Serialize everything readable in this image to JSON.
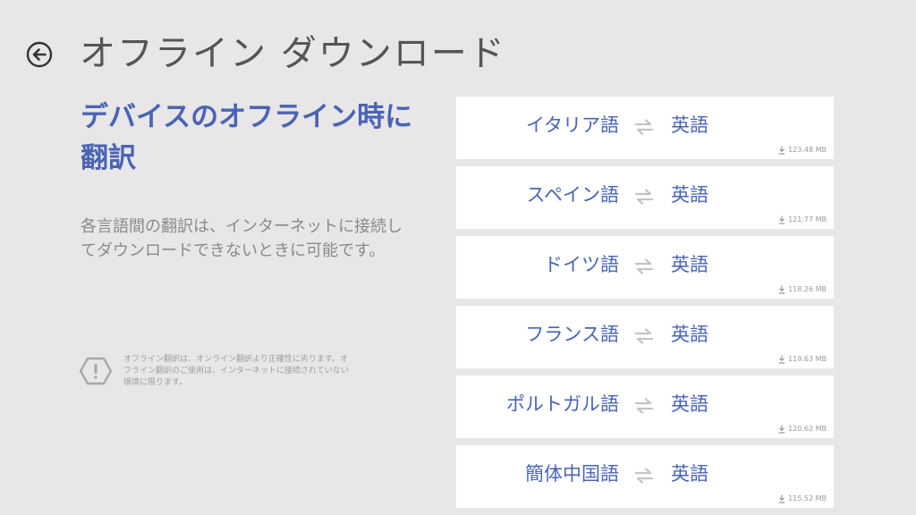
{
  "header": {
    "back_icon": "arrow-left-circle-icon",
    "title": "オフライン ダウンロード"
  },
  "intro": {
    "headline": "デバイスのオフライン時に翻訳",
    "description": "各言語間の翻訳は、インターネットに接続してダウンロードできないときに可能です。"
  },
  "notice": {
    "icon": "warning-hexagon-icon",
    "text": "オフライン翻訳は、オンライン翻訳より正確性に劣ります。オフライン翻訳のご使用は、インターネットに接続されていない環境に限ります。"
  },
  "languages": [
    {
      "source": "イタリア語",
      "target": "英語",
      "size": "123.48 MB"
    },
    {
      "source": "スペイン語",
      "target": "英語",
      "size": "121.77 MB"
    },
    {
      "source": "ドイツ語",
      "target": "英語",
      "size": "118.26 MB"
    },
    {
      "source": "フランス語",
      "target": "英語",
      "size": "119.63 MB"
    },
    {
      "source": "ポルトガル語",
      "target": "英語",
      "size": "120.62 MB"
    },
    {
      "source": "簡体中国語",
      "target": "英語",
      "size": "115.52 MB"
    }
  ],
  "icons": {
    "swap": "swap-arrows-icon",
    "download": "download-icon"
  },
  "colors": {
    "background": "#e8e6e6",
    "accent": "#4a64b5",
    "card": "#ffffff",
    "muted_text": "#8a8a8a"
  }
}
